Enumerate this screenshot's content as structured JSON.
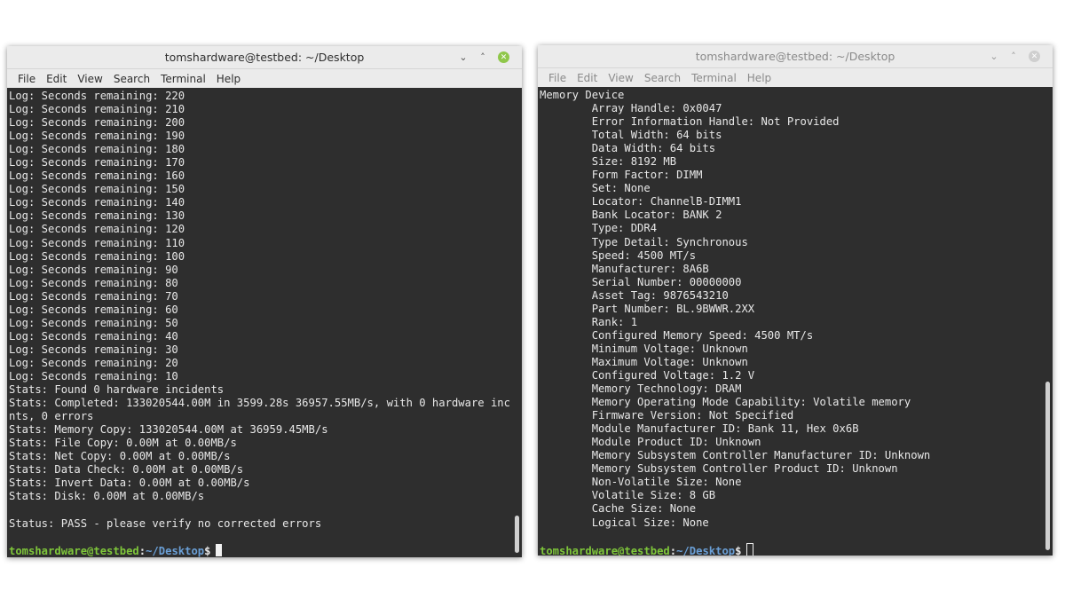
{
  "left": {
    "title": "tomshardware@testbed: ~/Desktop",
    "menu": [
      "File",
      "Edit",
      "View",
      "Search",
      "Terminal",
      "Help"
    ],
    "lines": [
      "Log: Seconds remaining: 220",
      "Log: Seconds remaining: 210",
      "Log: Seconds remaining: 200",
      "Log: Seconds remaining: 190",
      "Log: Seconds remaining: 180",
      "Log: Seconds remaining: 170",
      "Log: Seconds remaining: 160",
      "Log: Seconds remaining: 150",
      "Log: Seconds remaining: 140",
      "Log: Seconds remaining: 130",
      "Log: Seconds remaining: 120",
      "Log: Seconds remaining: 110",
      "Log: Seconds remaining: 100",
      "Log: Seconds remaining: 90",
      "Log: Seconds remaining: 80",
      "Log: Seconds remaining: 70",
      "Log: Seconds remaining: 60",
      "Log: Seconds remaining: 50",
      "Log: Seconds remaining: 40",
      "Log: Seconds remaining: 30",
      "Log: Seconds remaining: 20",
      "Log: Seconds remaining: 10",
      "Stats: Found 0 hardware incidents",
      "Stats: Completed: 133020544.00M in 3599.28s 36957.55MB/s, with 0 hardware incide",
      "nts, 0 errors",
      "Stats: Memory Copy: 133020544.00M at 36959.45MB/s",
      "Stats: File Copy: 0.00M at 0.00MB/s",
      "Stats: Net Copy: 0.00M at 0.00MB/s",
      "Stats: Data Check: 0.00M at 0.00MB/s",
      "Stats: Invert Data: 0.00M at 0.00MB/s",
      "Stats: Disk: 0.00M at 0.00MB/s",
      "",
      "Status: PASS - please verify no corrected errors",
      ""
    ],
    "prompt": {
      "user": "tomshardware@testbed",
      "sep": ":",
      "path": "~/Desktop",
      "symbol": "$"
    }
  },
  "right": {
    "title": "tomshardware@testbed: ~/Desktop",
    "menu": [
      "File",
      "Edit",
      "View",
      "Search",
      "Terminal",
      "Help"
    ],
    "lines": [
      "Memory Device",
      "        Array Handle: 0x0047",
      "        Error Information Handle: Not Provided",
      "        Total Width: 64 bits",
      "        Data Width: 64 bits",
      "        Size: 8192 MB",
      "        Form Factor: DIMM",
      "        Set: None",
      "        Locator: ChannelB-DIMM1",
      "        Bank Locator: BANK 2",
      "        Type: DDR4",
      "        Type Detail: Synchronous",
      "        Speed: 4500 MT/s",
      "        Manufacturer: 8A6B",
      "        Serial Number: 00000000",
      "        Asset Tag: 9876543210",
      "        Part Number: BL.9BWWR.2XX",
      "        Rank: 1",
      "        Configured Memory Speed: 4500 MT/s",
      "        Minimum Voltage: Unknown",
      "        Maximum Voltage: Unknown",
      "        Configured Voltage: 1.2 V",
      "        Memory Technology: DRAM",
      "        Memory Operating Mode Capability: Volatile memory",
      "        Firmware Version: Not Specified",
      "        Module Manufacturer ID: Bank 11, Hex 0x6B",
      "        Module Product ID: Unknown",
      "        Memory Subsystem Controller Manufacturer ID: Unknown",
      "        Memory Subsystem Controller Product ID: Unknown",
      "        Non-Volatile Size: None",
      "        Volatile Size: 8 GB",
      "        Cache Size: None",
      "        Logical Size: None",
      ""
    ],
    "prompt": {
      "user": "tomshardware@testbed",
      "sep": ":",
      "path": "~/Desktop",
      "symbol": "$"
    }
  },
  "icons": {
    "minimize": "minimize-icon",
    "maximize": "maximize-icon",
    "close": "close-icon"
  }
}
